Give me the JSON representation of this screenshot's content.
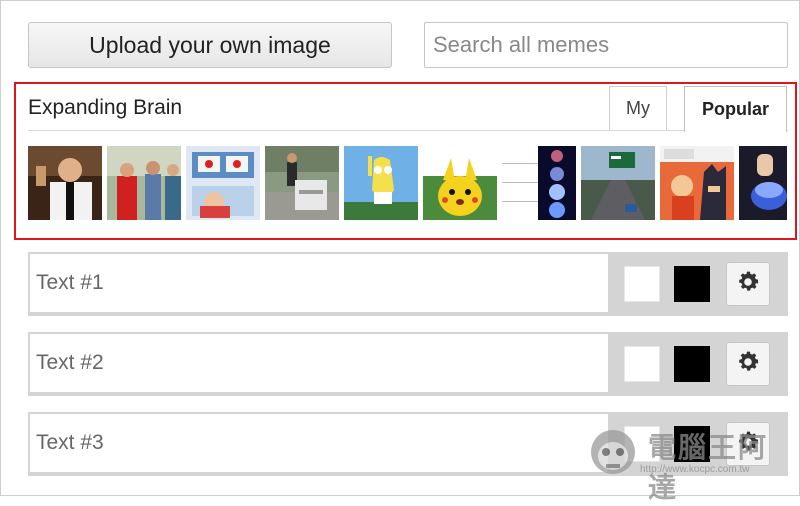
{
  "toolbar": {
    "upload_label": "Upload your own image",
    "search_placeholder": "Search all memes"
  },
  "template_panel": {
    "selected_title": "Expanding Brain",
    "tabs": [
      {
        "label": "My",
        "active": false
      },
      {
        "label": "Popular",
        "active": true
      }
    ],
    "thumbnails": [
      {
        "name": "leonardo-toast-thumb"
      },
      {
        "name": "distracted-boyfriend-thumb"
      },
      {
        "name": "two-buttons-thumb"
      },
      {
        "name": "guy-cart-thumb"
      },
      {
        "name": "mocking-spongebob-thumb"
      },
      {
        "name": "surprised-pikachu-thumb"
      },
      {
        "name": "expanding-brain-thumb"
      },
      {
        "name": "left-exit-ramp-thumb"
      },
      {
        "name": "batman-slap-thumb"
      },
      {
        "name": "hand-button-thumb"
      }
    ]
  },
  "text_boxes": [
    {
      "placeholder": "Text #1",
      "fill_color": "#ffffff",
      "outline_color": "#000000",
      "settings_icon": "gear-icon"
    },
    {
      "placeholder": "Text #2",
      "fill_color": "#ffffff",
      "outline_color": "#000000",
      "settings_icon": "gear-icon"
    },
    {
      "placeholder": "Text #3",
      "fill_color": "#ffffff",
      "outline_color": "#000000",
      "settings_icon": "gear-icon"
    }
  ],
  "watermark": {
    "text": "電腦王阿達",
    "url": "http://www.kocpc.com.tw"
  },
  "colors": {
    "highlight": "#e0141d",
    "row_background": "#d4d4d4"
  }
}
